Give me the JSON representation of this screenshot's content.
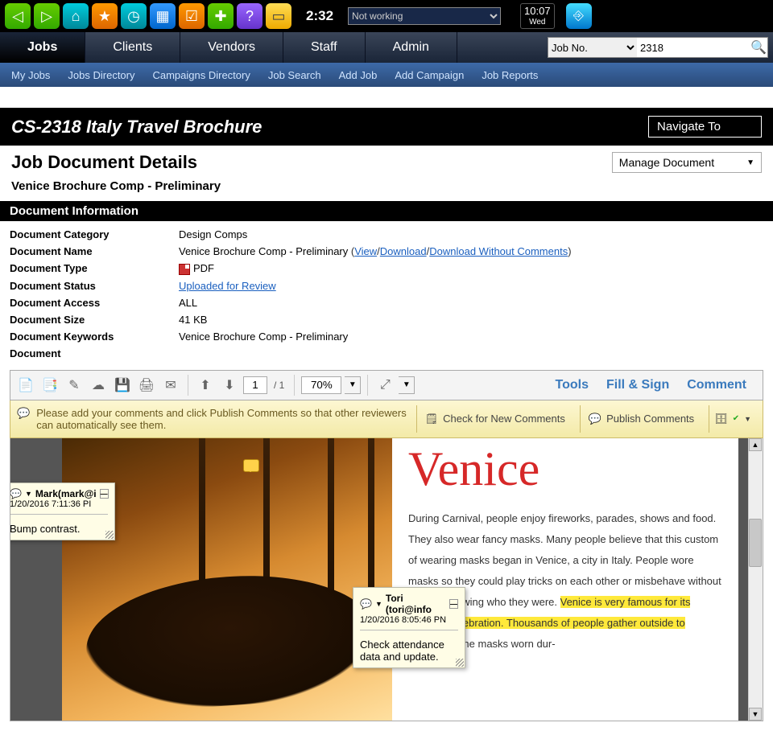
{
  "topbar": {
    "timer": "2:32",
    "status_select": "Not working",
    "clock_time": "10:07",
    "clock_day": "Wed"
  },
  "nav": {
    "tabs": [
      "Jobs",
      "Clients",
      "Vendors",
      "Staff",
      "Admin"
    ],
    "active_tab": "Jobs",
    "jobno_label": "Job No.",
    "jobno_value": "2318"
  },
  "subnav": [
    "My Jobs",
    "Jobs Directory",
    "Campaigns Directory",
    "Job Search",
    "Add Job",
    "Add Campaign",
    "Job Reports"
  ],
  "titlebar": {
    "title": "CS-2318 Italy Travel Brochure",
    "navigate": "Navigate To"
  },
  "page": {
    "heading": "Job Document Details",
    "manage": "Manage Document",
    "subtitle": "Venice Brochure Comp - Preliminary",
    "section": "Document Information"
  },
  "info": {
    "category_label": "Document Category",
    "category_value": "Design Comps",
    "name_label": "Document Name",
    "name_value": "Venice Brochure Comp - Preliminary",
    "name_links": {
      "view": "View",
      "download": "Download",
      "dlwc": "Download Without Comments"
    },
    "type_label": "Document Type",
    "type_value": "PDF",
    "status_label": "Document Status",
    "status_value": "Uploaded for Review",
    "access_label": "Document Access",
    "access_value": "ALL",
    "size_label": "Document Size",
    "size_value": "41 KB",
    "keywords_label": "Document Keywords",
    "keywords_value": "Venice Brochure Comp - Preliminary",
    "doc_label": "Document"
  },
  "pdf_toolbar": {
    "page_current": "1",
    "page_total": "/ 1",
    "zoom": "70%",
    "tools": "Tools",
    "fill_sign": "Fill & Sign",
    "comment": "Comment"
  },
  "comment_bar": {
    "message": "Please add your comments and click Publish Comments so that other reviewers can automatically see them.",
    "check": "Check for New Comments",
    "publish": "Publish Comments"
  },
  "doc": {
    "heading": "Venice",
    "body_pre": "During Carnival, people enjoy fireworks, parades, shows and food. They also wear fancy masks. Many people believe that this custom of wearing masks began in Venice, a city in Italy. People wore masks so they could play tricks on each other or misbehave without anyone knowing who they were. ",
    "body_hl": "Venice is very famous for its Carnival celebration. Thousands of people gather outside to celebrate.",
    "body_post": " The masks worn dur-"
  },
  "notes": [
    {
      "author": "Mark(mark@i",
      "time": "1/20/2016 7:11:36 PI",
      "body": "Bump contrast."
    },
    {
      "author": "Tori (tori@info",
      "time": "1/20/2016 8:05:46 PN",
      "body": "Check attendance data and update."
    }
  ]
}
